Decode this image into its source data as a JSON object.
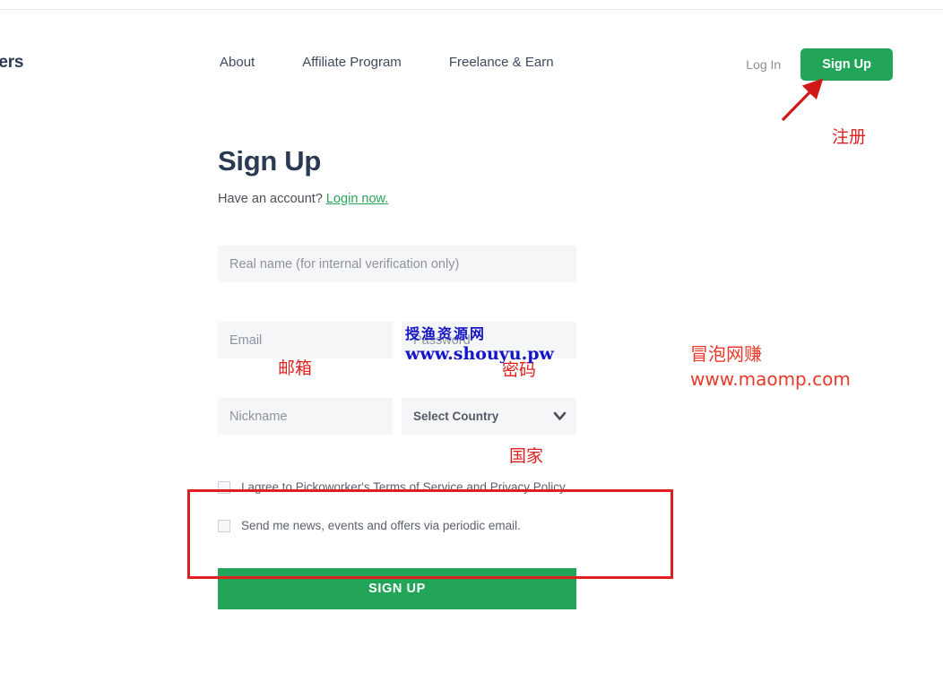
{
  "header": {
    "brand": "kers",
    "nav": [
      {
        "label": "About"
      },
      {
        "label": "Affiliate Program"
      },
      {
        "label": "Freelance & Earn"
      }
    ],
    "login_label": "Log In",
    "signup_label": "Sign Up"
  },
  "form": {
    "title": "Sign Up",
    "have_account_text": "Have an account?",
    "login_now_label": "Login now.",
    "real_name_placeholder": "Real name (for internal verification only)",
    "email_placeholder": "Email",
    "password_placeholder": "Password",
    "nickname_placeholder": "Nickname",
    "country_selected": "Select Country",
    "country_options": [
      "Select Country"
    ],
    "terms_checkbox_label": "I agree to Pickoworker's Terms of Service and Privacy Policy.",
    "newsletter_checkbox_label": "Send me news, events and offers via periodic email.",
    "submit_label": "SIGN UP"
  },
  "annotations": {
    "signup_cn": "注册",
    "email_cn": "邮箱",
    "password_cn": "密码",
    "country_cn": "国家"
  },
  "watermarks": {
    "blue_cn": "授渔资源网",
    "blue_url": "www.shouyu.pw",
    "red_cn": "冒泡网赚",
    "red_url": "www.maomp.com"
  },
  "colors": {
    "brand_green": "#22a558",
    "heading_navy": "#2b3a54",
    "annotation_red": "#e02020",
    "input_bg": "#f5f6f8"
  }
}
